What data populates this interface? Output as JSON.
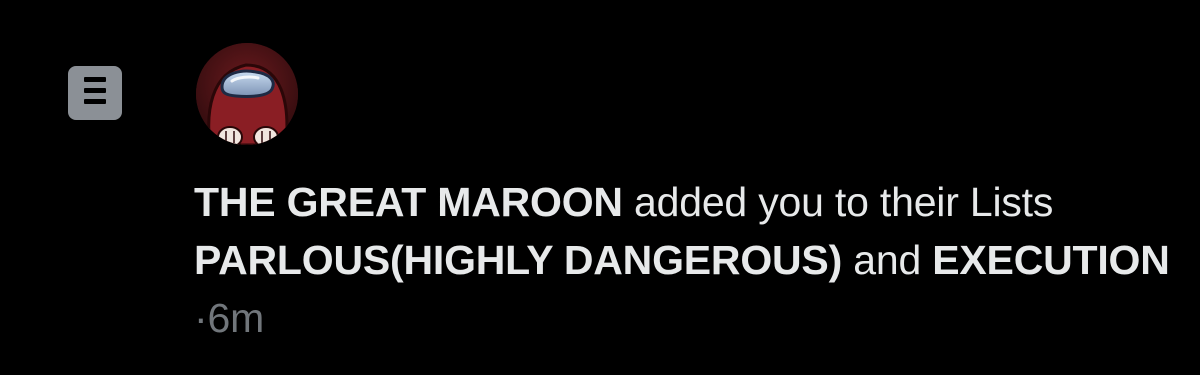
{
  "notification": {
    "actor_name": "THE GREAT MAROON",
    "text_added": "added you to their",
    "text_lists": "Lists",
    "list_one": "PARLOUS(HIGHLY DANGEROUS)",
    "text_and": "and",
    "list_two": "EXECUTION",
    "separator": "·",
    "time_ago": "6m",
    "icon": "list-icon",
    "avatar": "red-crewmate-avatar"
  },
  "colors": {
    "background": "#000000",
    "primary_text": "#e7e9ea",
    "secondary_text": "#71767b",
    "icon_background": "#8b9096"
  }
}
